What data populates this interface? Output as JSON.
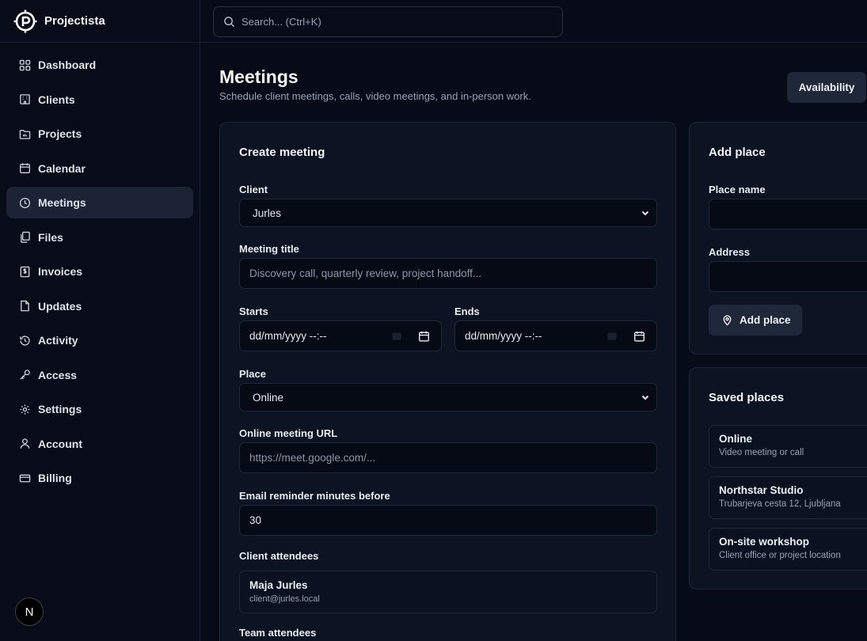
{
  "brand": {
    "name": "Projectista"
  },
  "search": {
    "placeholder": "Search... (Ctrl+K)"
  },
  "sidebar": {
    "items": [
      {
        "label": "Dashboard",
        "icon": "grid-icon"
      },
      {
        "label": "Clients",
        "icon": "building-icon"
      },
      {
        "label": "Projects",
        "icon": "folder-icon"
      },
      {
        "label": "Calendar",
        "icon": "calendar-icon"
      },
      {
        "label": "Meetings",
        "icon": "clock-icon",
        "active": true
      },
      {
        "label": "Files",
        "icon": "files-icon"
      },
      {
        "label": "Invoices",
        "icon": "invoice-icon"
      },
      {
        "label": "Updates",
        "icon": "document-icon"
      },
      {
        "label": "Activity",
        "icon": "activity-icon"
      },
      {
        "label": "Access",
        "icon": "key-icon"
      },
      {
        "label": "Settings",
        "icon": "gear-icon"
      },
      {
        "label": "Account",
        "icon": "user-icon"
      },
      {
        "label": "Billing",
        "icon": "credit-card-icon"
      }
    ],
    "avatar_letter": "N"
  },
  "header": {
    "title": "Meetings",
    "subtitle": "Schedule client meetings, calls, video meetings, and in-person work.",
    "availability_label": "Availability"
  },
  "create_meeting": {
    "title": "Create meeting",
    "client_label": "Client",
    "client_value": "Jurles",
    "meeting_title_label": "Meeting title",
    "meeting_title_placeholder": "Discovery call, quarterly review, project handoff...",
    "starts_label": "Starts",
    "starts_placeholder": "dd/mm/yyyy --:--",
    "ends_label": "Ends",
    "ends_placeholder": "dd/mm/yyyy --:--",
    "place_label": "Place",
    "place_value": "Online",
    "url_label": "Online meeting URL",
    "url_placeholder": "https://meet.google.com/...",
    "reminder_label": "Email reminder minutes before",
    "reminder_value": "30",
    "client_attendees_label": "Client attendees",
    "client_attendees": [
      {
        "name": "Maja Jurles",
        "email": "client@jurles.local"
      }
    ],
    "team_attendees_label": "Team attendees"
  },
  "add_place": {
    "title": "Add place",
    "place_name_label": "Place name",
    "address_label": "Address",
    "button_label": "Add place"
  },
  "saved_places": {
    "title": "Saved places",
    "items": [
      {
        "name": "Online",
        "desc": "Video meeting or call"
      },
      {
        "name": "Northstar Studio",
        "desc": "Trubarjeva cesta 12, Ljubljana"
      },
      {
        "name": "On-site workshop",
        "desc": "Client office or project location"
      }
    ]
  }
}
